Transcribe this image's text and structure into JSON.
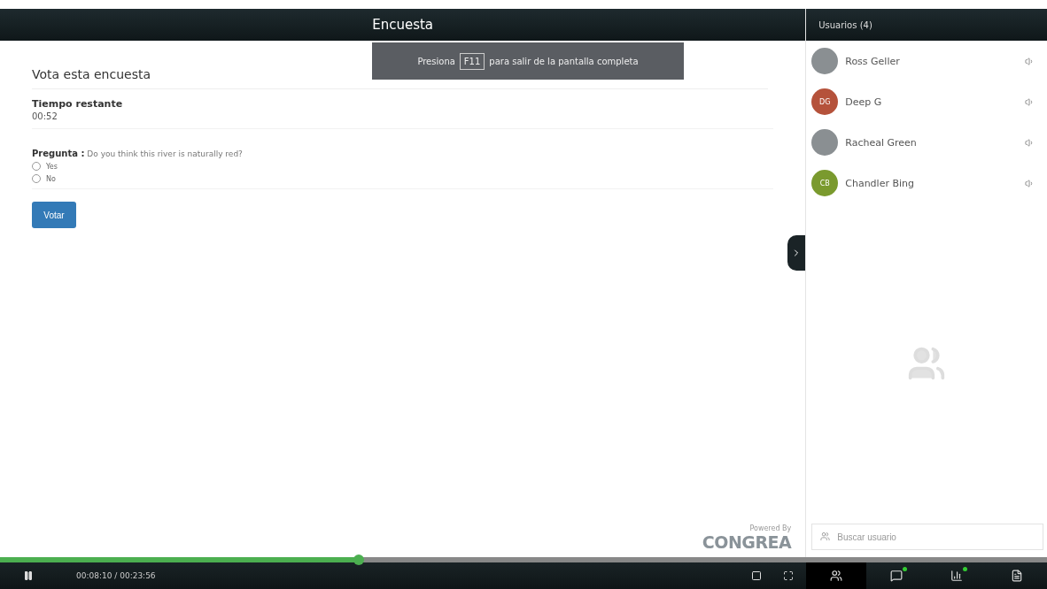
{
  "header": {
    "title": "Encuesta"
  },
  "toast": {
    "before": "Presiona",
    "key": "F11",
    "after": "para salir de la pantalla completa"
  },
  "poll": {
    "heading": "Vota esta encuesta",
    "timer_label": "Tiempo restante",
    "timer_value": "00:52",
    "question_label": "Pregunta :",
    "question": "Do you think this river is naturally red?",
    "options": [
      {
        "label": "Yes",
        "selected": false
      },
      {
        "label": "No",
        "selected": false
      }
    ],
    "button": "Votar"
  },
  "branding": {
    "powered": "Powered By",
    "logo": "CONGREA"
  },
  "sidebar": {
    "title": "Usuarios (4)",
    "users": [
      {
        "name": "Ross Geller",
        "kind": "photo"
      },
      {
        "name": "Deep G",
        "kind": "initials",
        "initials": "DG",
        "color": "#b5523b"
      },
      {
        "name": "Racheal Green",
        "kind": "photo"
      },
      {
        "name": "Chandler Bing",
        "kind": "initials",
        "initials": "CB",
        "color": "#7a9a2e"
      }
    ],
    "search": {
      "placeholder": "Buscar usuario"
    }
  },
  "player": {
    "level": 0.343,
    "time": "00:08:10 / 00:23:56"
  },
  "toolbar": [
    {
      "kind": "users",
      "selected": true,
      "badge": false
    },
    {
      "kind": "chat",
      "selected": false,
      "badge": true
    },
    {
      "kind": "poll",
      "selected": false,
      "badge": true
    },
    {
      "kind": "notes",
      "selected": false,
      "badge": false
    }
  ]
}
